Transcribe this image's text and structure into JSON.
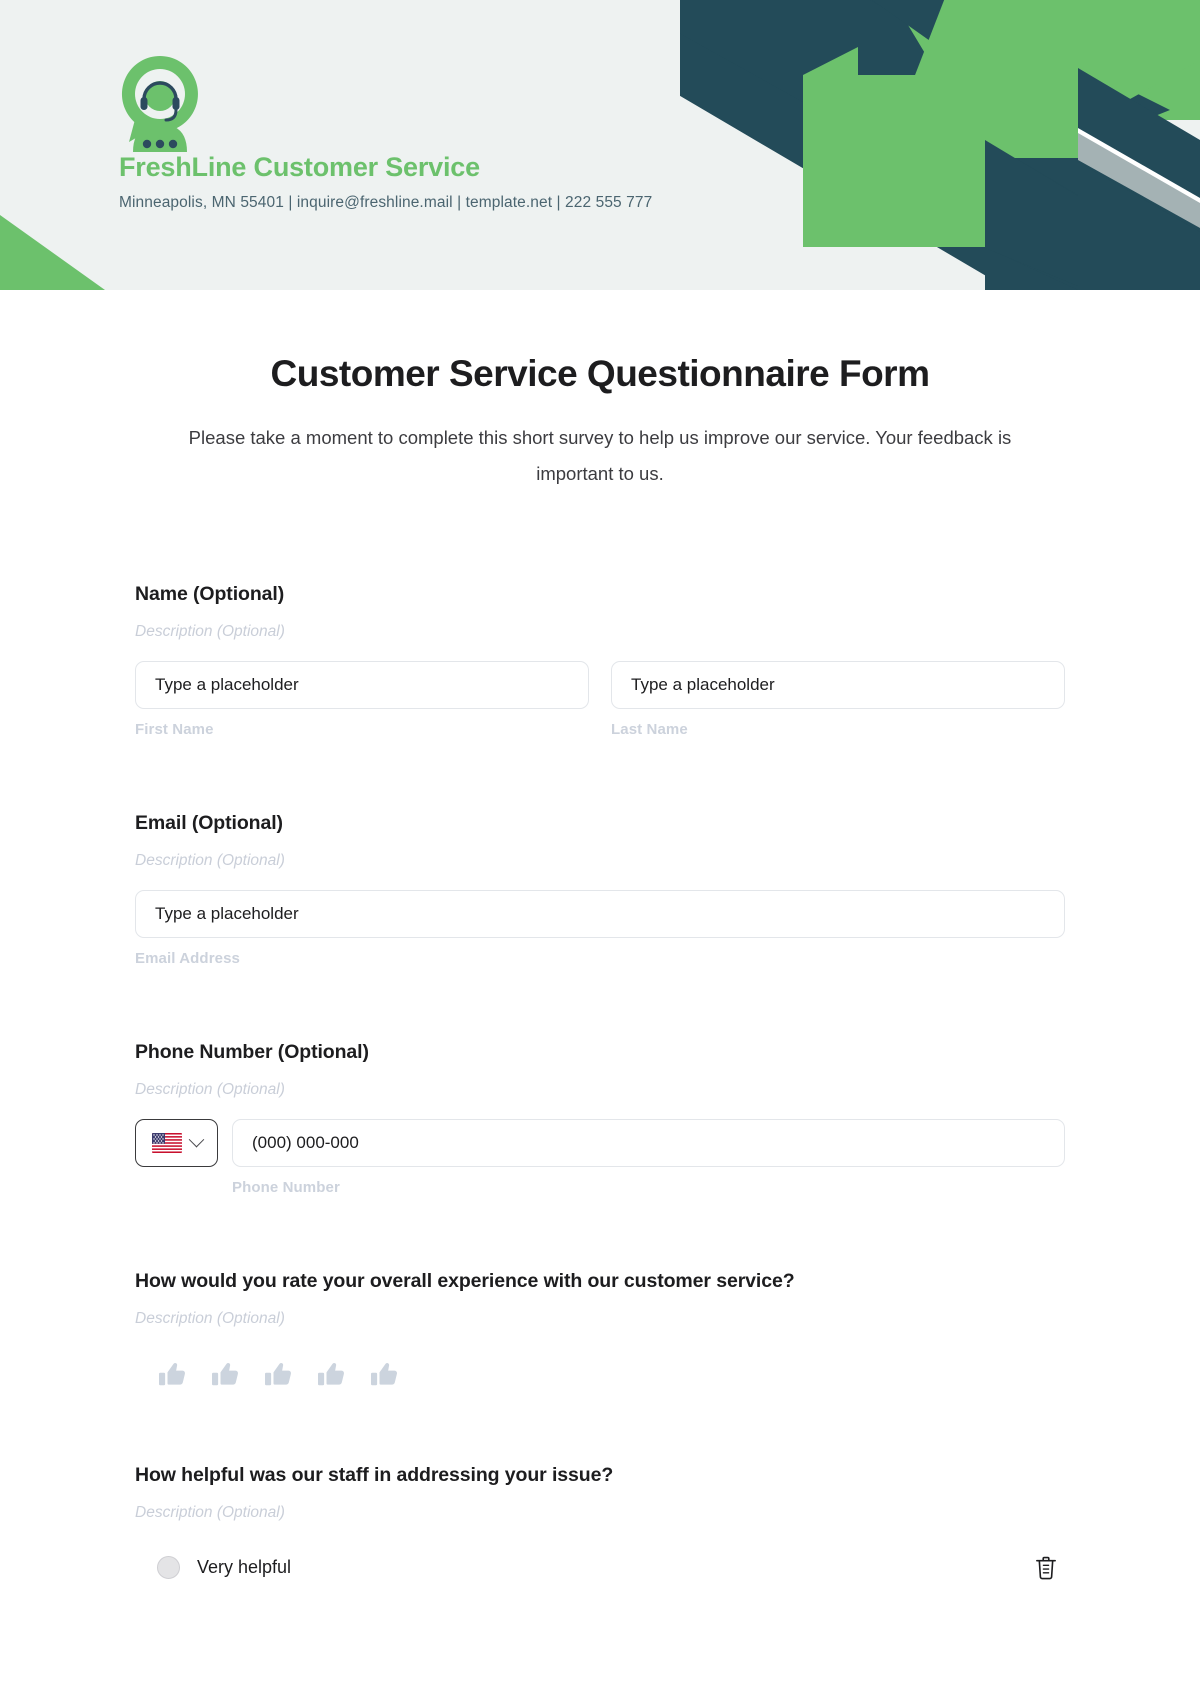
{
  "brand": {
    "logo_icon": "customer-service-headset-bubble-icon",
    "name": "FreshLine Customer Service",
    "contact_line": "Minneapolis, MN 55401 | inquire@freshline.mail | template.net | 222 555 777"
  },
  "colors": {
    "accent_green": "#6cc16c",
    "dark_teal": "#234b59",
    "header_bg": "#eef2f1",
    "silver": "#a4b2b4",
    "muted_label": "#ccd2dc",
    "thumb_gray": "#ccd4de"
  },
  "form": {
    "title": "Customer Service Questionnaire Form",
    "subtitle": "Please take a moment to complete this short survey to help us improve our service. Your feedback is important to us.",
    "questions": [
      {
        "label": "Name (Optional)",
        "description": "Description (Optional)",
        "type": "name",
        "fields": [
          {
            "placeholder": "Type a placeholder",
            "sub_label": "First Name"
          },
          {
            "placeholder": "Type a placeholder",
            "sub_label": "Last Name"
          }
        ]
      },
      {
        "label": "Email (Optional)",
        "description": "Description (Optional)",
        "type": "email",
        "fields": [
          {
            "placeholder": "Type a placeholder",
            "sub_label": "Email Address"
          }
        ]
      },
      {
        "label": "Phone Number (Optional)",
        "description": "Description (Optional)",
        "type": "phone",
        "country_flag": "us-flag-icon",
        "dropdown_icon": "chevron-down-icon",
        "fields": [
          {
            "placeholder": "(000) 000-000",
            "sub_label": "Phone Number"
          }
        ]
      },
      {
        "label": "How would you rate your overall experience with our customer service?",
        "description": "Description (Optional)",
        "type": "thumbs-rating",
        "icon": "thumbs-up-icon",
        "count": 5
      },
      {
        "label": "How helpful was our staff in addressing your issue?",
        "description": "Description (Optional)",
        "type": "radio",
        "options": [
          {
            "text": "Very helpful"
          }
        ],
        "delete_icon": "trash-icon"
      }
    ]
  }
}
